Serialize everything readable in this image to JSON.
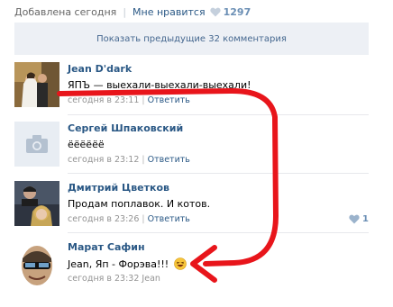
{
  "topbar": {
    "added": "Добавлена сегодня",
    "like_label": "Мне нравится",
    "like_count": "1297"
  },
  "show_previous": "Показать предыдущие 32 комментария",
  "comments": [
    {
      "author": "Jean D'dark",
      "text": "ЯПЪ — выехали-выехали-выехали!",
      "time": "сегодня в 23:11",
      "reply": "Ответить"
    },
    {
      "author": "Сергей Шпаковский",
      "text": "ёёёёёё",
      "time": "сегодня в 23:12",
      "reply": "Ответить"
    },
    {
      "author": "Дмитрий Цветков",
      "text": "Продам поплавок. И котов.",
      "time": "сегодня в 23:26",
      "reply": "Ответить",
      "likes": "1"
    },
    {
      "author": "Марат Сафин",
      "text": "Jean, Яп - Форэва!!!",
      "time": "сегодня в 23:32",
      "reply_to": "Jean"
    }
  ],
  "colors": {
    "link": "#2a5885",
    "annotation_arrow": "#e8151b",
    "panel": "#edf0f5"
  }
}
